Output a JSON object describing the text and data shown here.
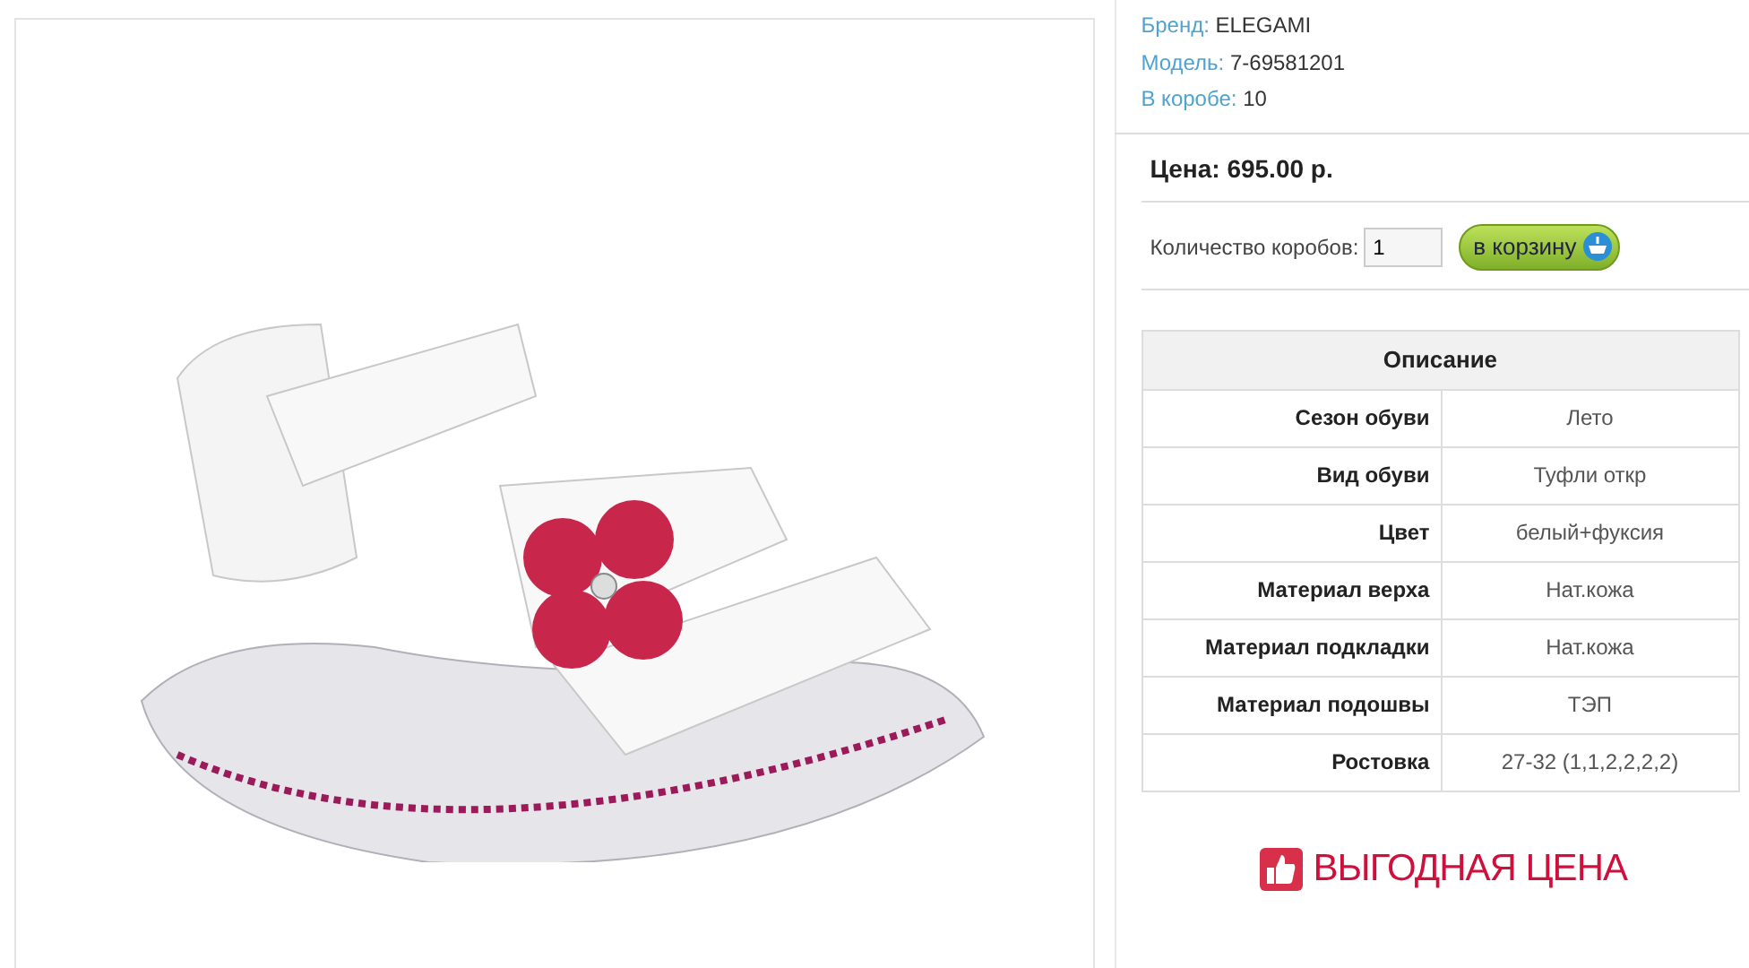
{
  "product": {
    "info": [
      {
        "label": "Бренд:",
        "value": "ELEGAMI"
      },
      {
        "label": "Модель:",
        "value": "7-69581201"
      },
      {
        "label": "В коробе:",
        "value": "10"
      }
    ],
    "price": "Цена: 695.00 р.",
    "quantity": {
      "label": "Количество коробов:",
      "value": "1"
    },
    "cart_button": "в корзину",
    "description": {
      "title": "Описание",
      "rows": [
        {
          "name": "Сезон обуви",
          "value": "Лето"
        },
        {
          "name": "Вид обуви",
          "value": "Туфли откр"
        },
        {
          "name": "Цвет",
          "value": "белый+фуксия"
        },
        {
          "name": "Материал верха",
          "value": "Нат.кожа"
        },
        {
          "name": "Материал подкладки",
          "value": "Нат.кожа"
        },
        {
          "name": "Материал подошвы",
          "value": "ТЭП"
        },
        {
          "name": "Ростовка",
          "value": "27-32 (1,1,2,2,2,2)"
        }
      ]
    },
    "promo": "ВЫГОДНАЯ ЦЕНА"
  }
}
